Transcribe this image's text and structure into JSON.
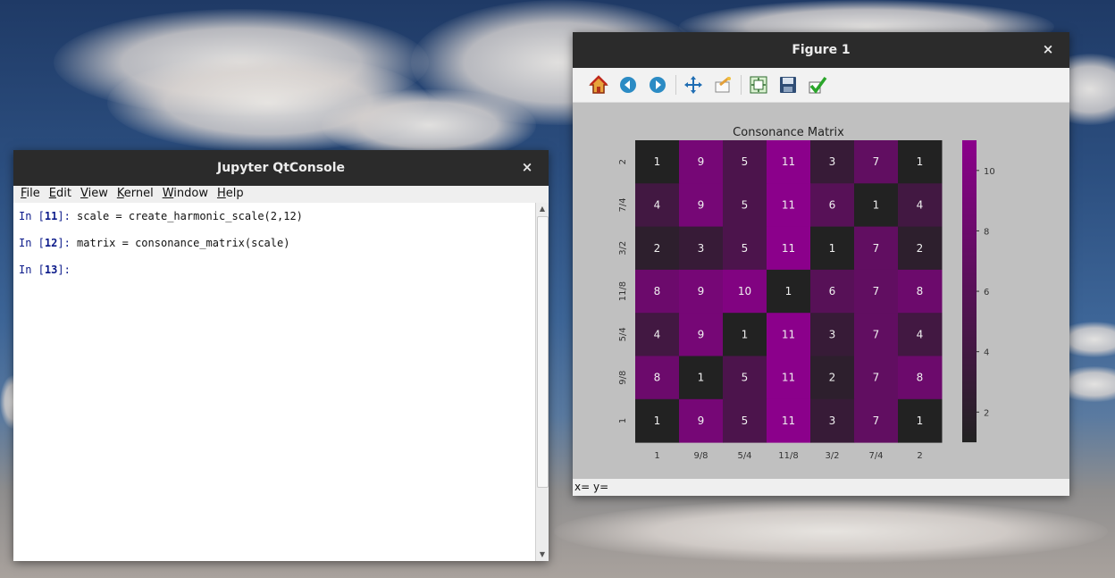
{
  "jupyter": {
    "title": "Jupyter QtConsole",
    "close": "×",
    "menu": [
      {
        "label": "File",
        "u": "F",
        "rest": "ile"
      },
      {
        "label": "Edit",
        "u": "E",
        "rest": "dit"
      },
      {
        "label": "View",
        "u": "V",
        "rest": "iew"
      },
      {
        "label": "Kernel",
        "u": "K",
        "rest": "ernel"
      },
      {
        "label": "Window",
        "u": "W",
        "rest": "indow"
      },
      {
        "label": "Help",
        "u": "H",
        "rest": "elp"
      }
    ],
    "cells": [
      {
        "prompt_pre": "In [",
        "num": "11",
        "prompt_post": "]: ",
        "code": "scale = create_harmonic_scale(2,12)"
      },
      {
        "prompt_pre": "In [",
        "num": "12",
        "prompt_post": "]: ",
        "code": "matrix = consonance_matrix(scale)"
      },
      {
        "prompt_pre": "In [",
        "num": "13",
        "prompt_post": "]:",
        "code": ""
      }
    ]
  },
  "figure": {
    "title": "Figure 1",
    "close": "×",
    "toolbar": [
      "home-icon",
      "back-icon",
      "forward-icon",
      "pan-icon",
      "zoom-icon",
      "subplots-icon",
      "save-icon",
      "check-icon"
    ],
    "status": "x= y="
  },
  "colors": {
    "min": "#222222",
    "max": "#8b008b"
  },
  "chart_data": {
    "type": "heatmap",
    "title": "Consonance Matrix",
    "x_labels": [
      "1",
      "9/8",
      "5/4",
      "11/8",
      "3/2",
      "7/4",
      "2"
    ],
    "y_labels": [
      "2",
      "7/4",
      "3/2",
      "11/8",
      "5/4",
      "9/8",
      "1"
    ],
    "values": [
      [
        1,
        9,
        5,
        11,
        3,
        7,
        1
      ],
      [
        4,
        9,
        5,
        11,
        6,
        1,
        4
      ],
      [
        2,
        3,
        5,
        11,
        1,
        7,
        2
      ],
      [
        8,
        9,
        10,
        1,
        6,
        7,
        8
      ],
      [
        4,
        9,
        1,
        11,
        3,
        7,
        4
      ],
      [
        8,
        1,
        5,
        11,
        2,
        7,
        8
      ],
      [
        1,
        9,
        5,
        11,
        3,
        7,
        1
      ]
    ],
    "vmin": 1,
    "vmax": 11,
    "colorbar_ticks": [
      2,
      4,
      6,
      8,
      10
    ]
  }
}
